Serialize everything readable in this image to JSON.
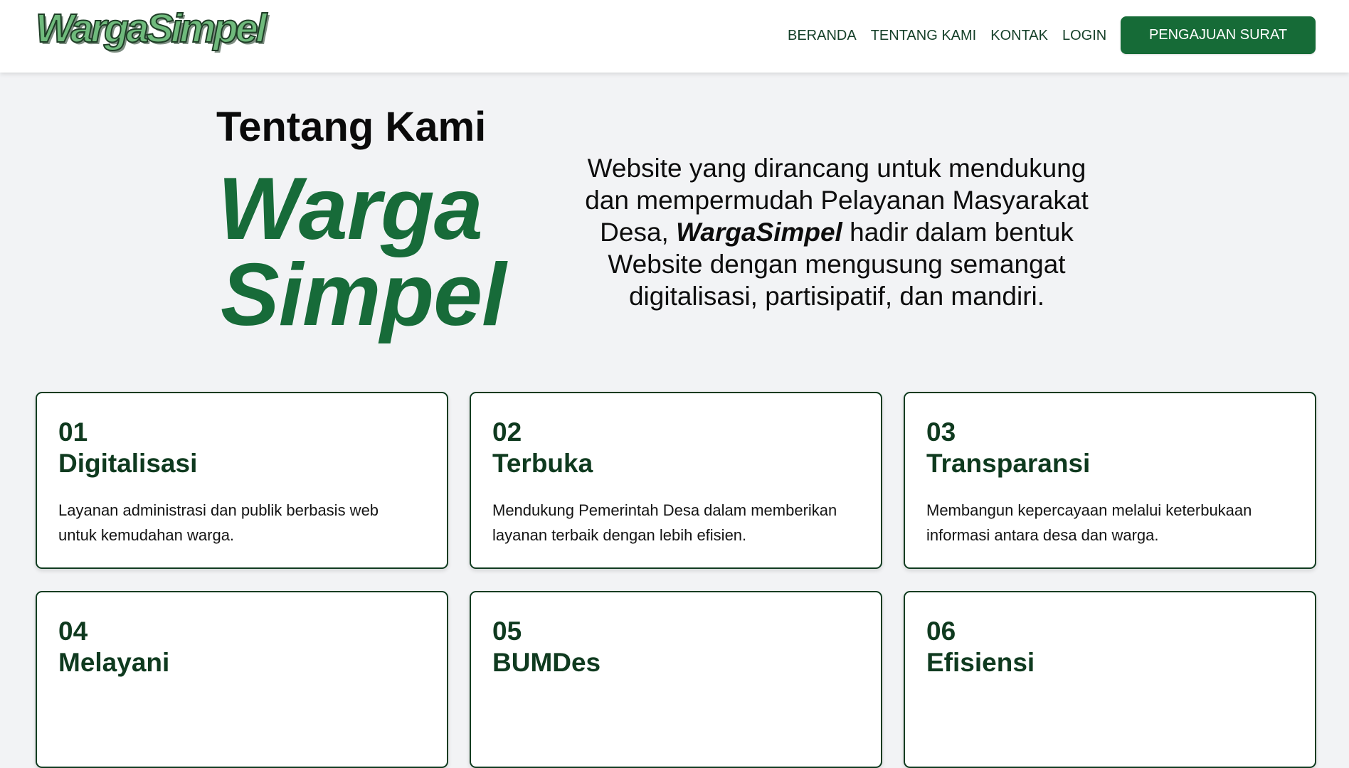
{
  "header": {
    "logo_text": "WargaSimpel",
    "nav": [
      "BERANDA",
      "TENTANG KAMI",
      "KONTAK",
      "LOGIN"
    ],
    "cta_label": "PENGAJUAN SURAT"
  },
  "hero": {
    "title": "Tentang Kami",
    "brand_line1": "Warga",
    "brand_line2": "Simpel",
    "description_before": "Website yang dirancang untuk mendukung dan mempermudah Pelayanan Masyarakat Desa, ",
    "description_brand": "WargaSimpel",
    "description_after": " hadir dalam bentuk Website dengan mengusung semangat digitalisasi, partisipatif, dan mandiri."
  },
  "cards": [
    {
      "number": "01",
      "title": "Digitalisasi",
      "text": "Layanan administrasi dan publik berbasis web untuk kemudahan warga."
    },
    {
      "number": "02",
      "title": "Terbuka",
      "text": "Mendukung Pemerintah Desa dalam memberikan layanan terbaik dengan lebih efisien."
    },
    {
      "number": "03",
      "title": "Transparansi",
      "text": "Membangun kepercayaan melalui keterbukaan informasi antara desa dan warga."
    },
    {
      "number": "04",
      "title": "Melayani",
      "text": ""
    },
    {
      "number": "05",
      "title": "BUMDes",
      "text": ""
    },
    {
      "number": "06",
      "title": "Efisiensi",
      "text": ""
    }
  ],
  "colors": {
    "brand_green": "#166b37",
    "dark_green": "#0f3a1f",
    "logo_green": "#6fba7c",
    "page_background": "#f2f3f5"
  }
}
